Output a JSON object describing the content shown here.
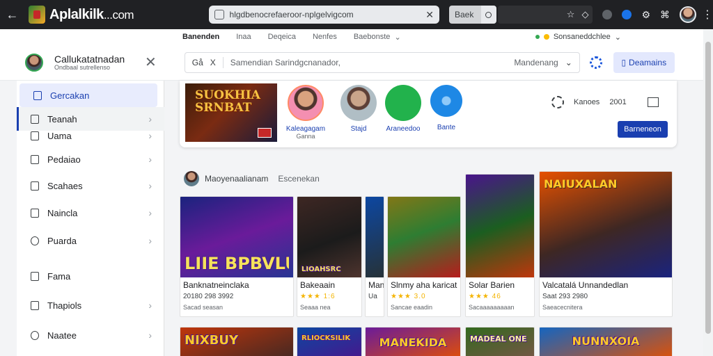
{
  "browser": {
    "brand": "Aplalkilk",
    "brand_suffix": "...com",
    "url": "hlgdbenocrefaeroor-nplgelvigcom",
    "seg_label": "Baek"
  },
  "topnav": {
    "links": [
      "Banenden",
      "Inaa",
      "Deqeica",
      "Nenfes",
      "Baebonste"
    ],
    "right_label": "Sonsaneddchlee"
  },
  "header": {
    "profile_name": "Callukatatnadan",
    "profile_sub": "Ondbaal sutrellenso",
    "search_q": "Gå",
    "search_x": "X",
    "search_placeholder": "Samendian  Sarindgcnanador,",
    "search_filter": "Mandenang",
    "domains_button": "Deamains"
  },
  "sidebar": {
    "items": [
      {
        "label": "Gercakan"
      },
      {
        "label": "Teanah"
      },
      {
        "label": "Uama"
      },
      {
        "label": "Pedaiao"
      },
      {
        "label": "Scahaes"
      },
      {
        "label": "Naincla"
      },
      {
        "label": "Puarda"
      },
      {
        "label": "Fama"
      },
      {
        "label": "Thapiols"
      },
      {
        "label": "Naatee"
      }
    ]
  },
  "featured": {
    "banner_title": "SUOKHIA\nSRNBAT",
    "apps": [
      {
        "label": "Kaleagagam",
        "sub": "Ganna"
      },
      {
        "label": "Stajd",
        "sub": ""
      },
      {
        "label": "Araneedoo",
        "sub": ""
      },
      {
        "label": "Bante",
        "sub": ""
      }
    ],
    "stat_label": "Kanoes",
    "stat_value": "2001",
    "cta": "Barneneon"
  },
  "section": {
    "title": "Maoyenaalianam",
    "subtitle": "Escenekan"
  },
  "cards": [
    {
      "art_text": "LIIE BPBVLU",
      "title": "Banknatneinclaka",
      "meta": "20180 298 3992",
      "sub": "Sacad seasan"
    },
    {
      "art_text": "LIOAHSRC",
      "title": "Bakeaain",
      "meta": "★★★ 1:6",
      "sub": "Seaaa nea"
    },
    {
      "art_text": "",
      "title": "Man",
      "meta": "Ua",
      "sub": ""
    },
    {
      "art_text": "",
      "title": "Slnmy aha karicat",
      "meta": "★★★ 3.0",
      "sub": "Sancae eaadin"
    },
    {
      "art_text": "",
      "title": "Solar Barien",
      "meta": "★★★ 46",
      "sub": "Sacaaaaaaaaan"
    },
    {
      "art_text": "NAIUXALAN",
      "title": "Valcatalá Unnandedlan",
      "meta": "Saat 293 2980",
      "sub": "Saeacecnitera"
    }
  ],
  "bottom_cards": [
    {
      "art_text": "NIXBUY"
    },
    {
      "art_text": "RLIOCKSILIK"
    },
    {
      "art_text": "MANEKIDA"
    },
    {
      "art_text": "MADEAL ONE"
    },
    {
      "art_text": "NUNNXOIA"
    }
  ]
}
